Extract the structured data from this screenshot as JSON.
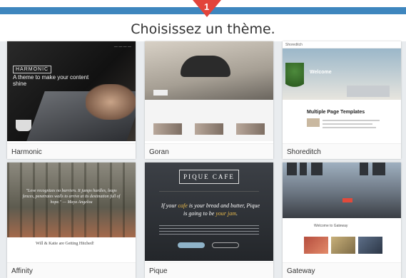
{
  "header": {
    "title": "Choisissez un thème.",
    "marker_number": "1",
    "accent": "#3e86be",
    "marker_color": "#e2443b"
  },
  "themes": [
    {
      "name": "Harmonic",
      "preview": {
        "logo": "HARMONIC",
        "tagline": "A theme to make your content shine"
      }
    },
    {
      "name": "Goran",
      "preview": {
        "label": "Goran"
      }
    },
    {
      "name": "Shoreditch",
      "preview": {
        "site": "Shoreditch",
        "welcome": "Welcome",
        "section_title": "Multiple Page Templates"
      }
    },
    {
      "name": "Affinity",
      "preview": {
        "quote": "\"Love recognizes no barriers. It jumps hurdles, leaps fences, penetrates walls to arrive at its destination full of hope.\" — Maya Angelou",
        "caption": "Will & Katie are Getting Hitched!"
      }
    },
    {
      "name": "Pique",
      "preview": {
        "logo": "PIQUE CAFE",
        "tagline_a": "If your ",
        "tagline_b": "cafe",
        "tagline_c": " is your bread and butter, Pique is going to be ",
        "tagline_d": "your jam",
        "tagline_e": "."
      }
    },
    {
      "name": "Gateway",
      "preview": {
        "welcome": "Welcome to Gateway"
      }
    }
  ]
}
